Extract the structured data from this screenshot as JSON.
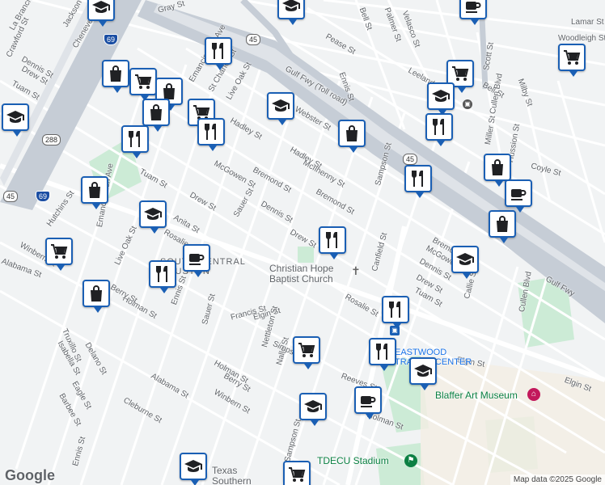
{
  "map": {
    "street_labels": [
      {
        "text": "Gray St"
      },
      {
        "text": "Bell St"
      },
      {
        "text": "Palmer St"
      },
      {
        "text": "Velasco St"
      },
      {
        "text": "Lamar St"
      },
      {
        "text": "Woodleigh St"
      },
      {
        "text": "Pease St"
      },
      {
        "text": "Ennis St"
      },
      {
        "text": "Scott St"
      },
      {
        "text": "Leeland St"
      },
      {
        "text": "Bell St"
      },
      {
        "text": "Milby St"
      },
      {
        "text": "Gulf Fwy (Toll road)"
      },
      {
        "text": "Gulf Fwy"
      },
      {
        "text": "Webster St"
      },
      {
        "text": "Hadley St"
      },
      {
        "text": "Hadley St"
      },
      {
        "text": "McIlhenny St"
      },
      {
        "text": "Bremond St"
      },
      {
        "text": "Bremond St"
      },
      {
        "text": "Sampson St"
      },
      {
        "text": "Coyle St"
      },
      {
        "text": "Hussion St"
      },
      {
        "text": "Miller St"
      },
      {
        "text": "McGowen St"
      },
      {
        "text": "Dennis St"
      },
      {
        "text": "Drew St"
      },
      {
        "text": "Drew St"
      },
      {
        "text": "Tuam St"
      },
      {
        "text": "Anita St"
      },
      {
        "text": "Rosalie St"
      },
      {
        "text": "Sauer St"
      },
      {
        "text": "Live Oak St"
      },
      {
        "text": "Elgin St"
      },
      {
        "text": "Hutchins St"
      },
      {
        "text": "Emancipation Ave"
      },
      {
        "text": "Winbern St"
      },
      {
        "text": "Alabama St"
      },
      {
        "text": "Holman St"
      },
      {
        "text": "Berry St"
      },
      {
        "text": "Ennis St"
      },
      {
        "text": "Truxillo St"
      },
      {
        "text": "Isabella St"
      },
      {
        "text": "Delano St"
      },
      {
        "text": "Francis St"
      },
      {
        "text": "Sauer St"
      },
      {
        "text": "Nettleton St"
      },
      {
        "text": "Holman St"
      },
      {
        "text": "Berry St"
      },
      {
        "text": "Winbern St"
      },
      {
        "text": "Nalle St"
      },
      {
        "text": "Simpson St"
      },
      {
        "text": "Alabama St"
      },
      {
        "text": "Elgin St"
      },
      {
        "text": "Reeves St"
      },
      {
        "text": "Holman St"
      },
      {
        "text": "Eagle St"
      },
      {
        "text": "Barbee St"
      },
      {
        "text": "Cleburne St"
      },
      {
        "text": "Sampson St"
      },
      {
        "text": "Ennis St"
      },
      {
        "text": "Bremond St"
      },
      {
        "text": "McGowen St"
      },
      {
        "text": "Dennis St"
      },
      {
        "text": "Drew St"
      },
      {
        "text": "Tuam St"
      },
      {
        "text": "Rosalie St"
      },
      {
        "text": "Canfield St"
      },
      {
        "text": "Cullen Blvd"
      },
      {
        "text": "Cullen Blvd"
      },
      {
        "text": "Callie St"
      },
      {
        "text": "Elgin St"
      },
      {
        "text": "Crawford St"
      },
      {
        "text": "Dennis St"
      },
      {
        "text": "Drew St"
      },
      {
        "text": "Tuam St"
      },
      {
        "text": "La Branch St"
      },
      {
        "text": "Jackson St"
      },
      {
        "text": "Chenevert St"
      },
      {
        "text": "Live Oak St"
      },
      {
        "text": "St Charles St"
      },
      {
        "text": "Emancipation Ave"
      }
    ],
    "poi_labels": {
      "church": "Christian Hope\nBaptist Church",
      "district": "SOUTH CENTRAL\nHOUSTON",
      "museum": "Blaffer Art Museum",
      "stadium": "TDECU Stadium",
      "university": "Texas\nSouthern",
      "transit": "EASTWOOD\nTRANSIT CENTER"
    },
    "shields": [
      "69",
      "69",
      "45",
      "45",
      "288",
      "45"
    ],
    "pins": [
      {
        "type": "education"
      },
      {
        "type": "education"
      },
      {
        "type": "coffee"
      },
      {
        "type": "restaurant"
      },
      {
        "type": "education"
      },
      {
        "type": "shopping-bag"
      },
      {
        "type": "grocery"
      },
      {
        "type": "shopping-bag"
      },
      {
        "type": "shopping-bag"
      },
      {
        "type": "grocery"
      },
      {
        "type": "grocery"
      },
      {
        "type": "education"
      },
      {
        "type": "education"
      },
      {
        "type": "restaurant"
      },
      {
        "type": "grocery"
      },
      {
        "type": "shopping-bag"
      },
      {
        "type": "restaurant"
      },
      {
        "type": "shopping-bag"
      },
      {
        "type": "restaurant"
      },
      {
        "type": "restaurant"
      },
      {
        "type": "shopping-bag"
      },
      {
        "type": "coffee"
      },
      {
        "type": "education"
      },
      {
        "type": "shopping-bag"
      },
      {
        "type": "restaurant"
      },
      {
        "type": "coffee"
      },
      {
        "type": "grocery"
      },
      {
        "type": "education"
      },
      {
        "type": "restaurant"
      },
      {
        "type": "restaurant"
      },
      {
        "type": "restaurant"
      },
      {
        "type": "shopping-bag"
      },
      {
        "type": "grocery"
      },
      {
        "type": "education"
      },
      {
        "type": "education"
      },
      {
        "type": "coffee"
      },
      {
        "type": "education"
      },
      {
        "type": "grocery"
      }
    ],
    "logo": "Google",
    "attribution": "Map data ©2025 Google"
  }
}
